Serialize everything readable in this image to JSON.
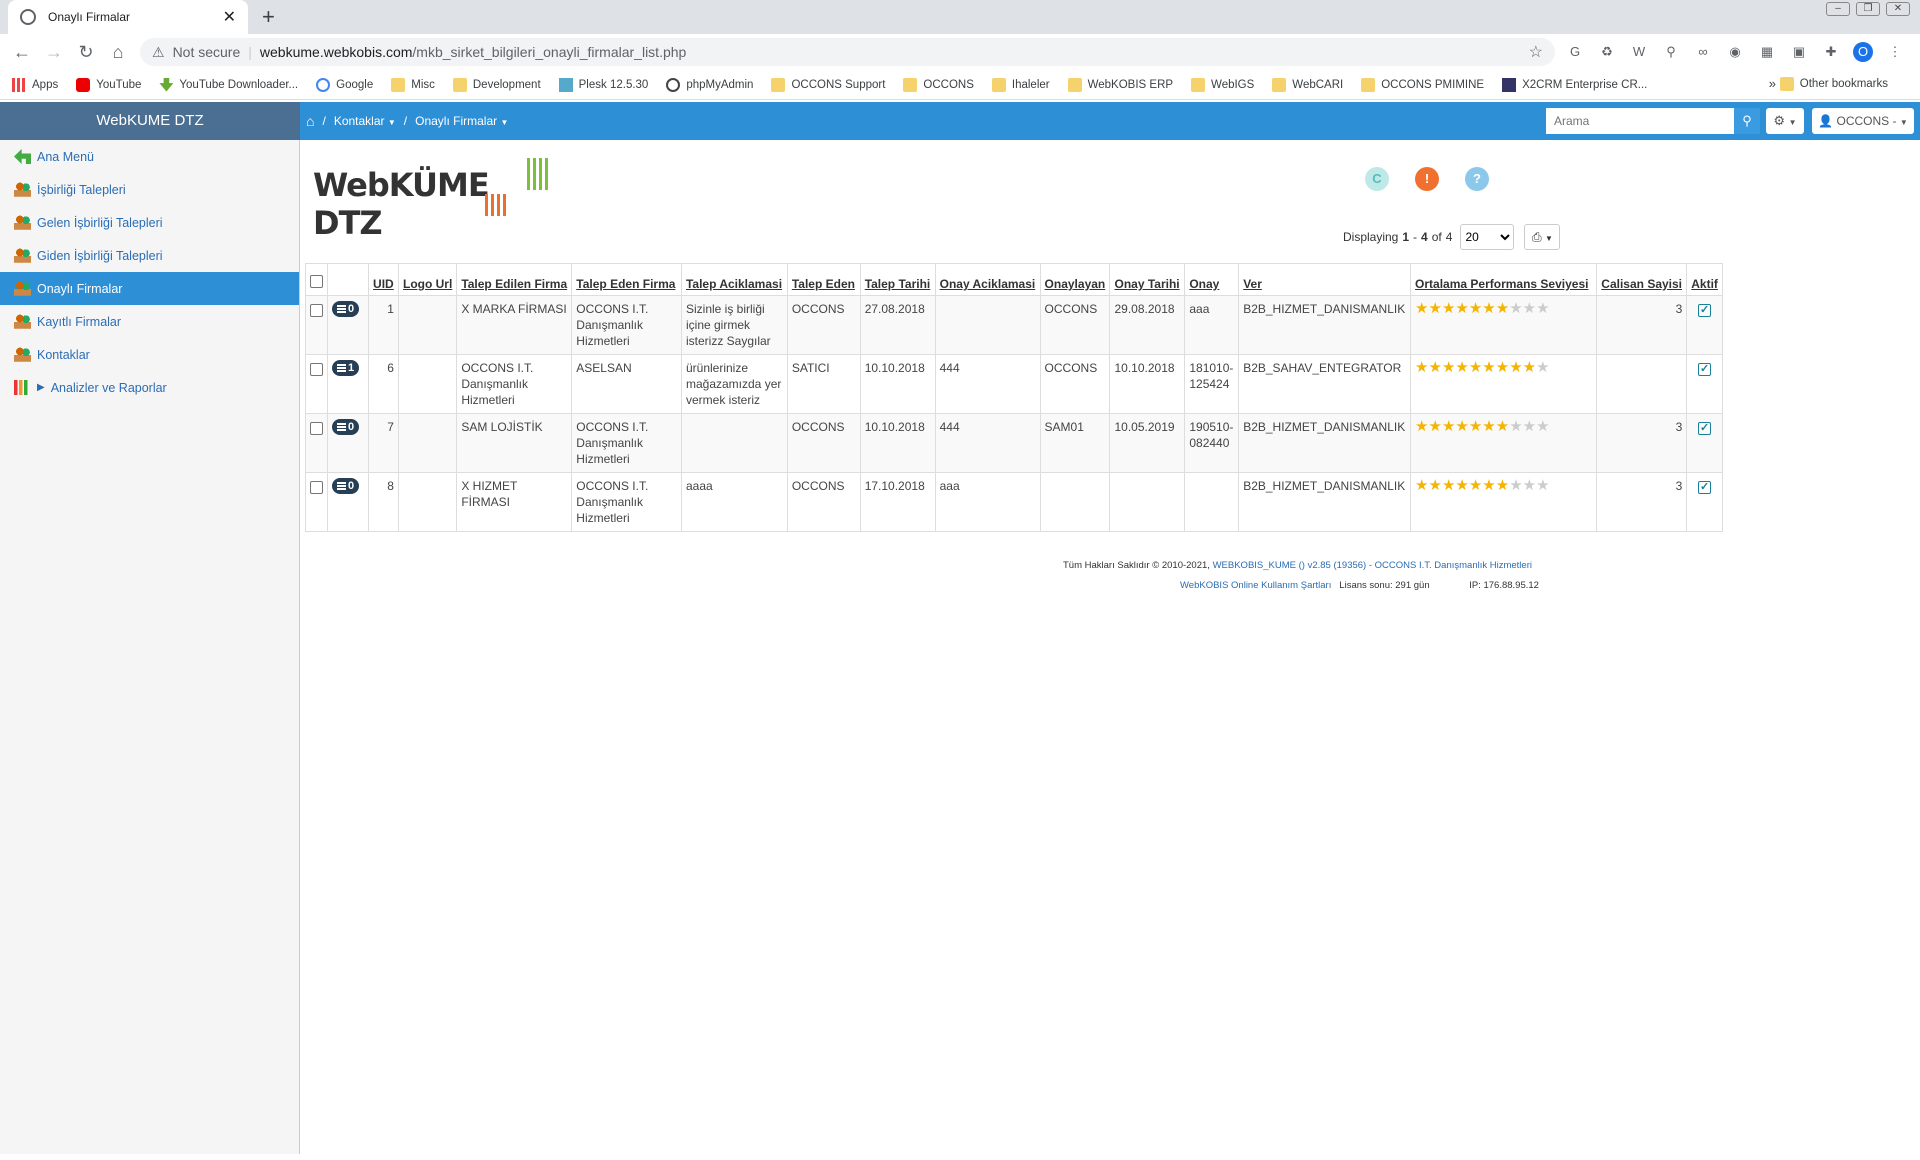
{
  "browser": {
    "tab_title": "Onaylı Firmalar",
    "url_warning": "Not secure",
    "url_host": "webkume.webkobis.com",
    "url_path": "/mkb_sirket_bilgileri_onayli_firmalar_list.php",
    "profile_initial": "O",
    "bookmarks": [
      "Apps",
      "YouTube",
      "YouTube Downloader...",
      "Google",
      "Misc",
      "Development",
      "Plesk 12.5.30",
      "phpMyAdmin",
      "OCCONS Support",
      "OCCONS",
      "Ihaleler",
      "WebKOBIS ERP",
      "WebIGS",
      "WebCARI",
      "OCCONS PMIMINE",
      "X2CRM Enterprise CR..."
    ],
    "bookmarks_more": "»",
    "other_bookmarks": "Other bookmarks"
  },
  "app": {
    "brand": "WebKUME DTZ",
    "logo_text": "WebKÜME DTZ",
    "breadcrumb": [
      "Kontaklar",
      "Onaylı Firmalar"
    ],
    "search_placeholder": "Arama",
    "user_label": "OCCONS -"
  },
  "sidebar": {
    "items": [
      {
        "label": "Ana Menü",
        "icon": "back-arrow-icon"
      },
      {
        "label": "İşbirliği Talepleri",
        "icon": "people-icon"
      },
      {
        "label": "Gelen İşbirliği Talepleri",
        "icon": "people-icon"
      },
      {
        "label": "Giden İşbirliği Talepleri",
        "icon": "people-icon"
      },
      {
        "label": "Onaylı Firmalar",
        "icon": "people-icon",
        "active": true
      },
      {
        "label": "Kayıtlı Firmalar",
        "icon": "people-icon"
      },
      {
        "label": "Kontaklar",
        "icon": "people-icon"
      },
      {
        "label": "Analizler ve Raporlar",
        "icon": "bar-chart-icon"
      }
    ]
  },
  "pager": {
    "prefix": "Displaying",
    "from": "1",
    "dash": "-",
    "to": "4",
    "of": "of",
    "total": "4",
    "page_size": "20"
  },
  "table": {
    "headers": [
      "UID",
      "Logo Url",
      "Talep Edilen Firma",
      "Talep Eden Firma",
      "Talep Aciklamasi",
      "Talep Eden",
      "Talep Tarihi",
      "Onay Aciklamasi",
      "Onaylayan",
      "Onay Tarihi",
      "Onay",
      "Ver",
      "Ortalama Performans Seviyesi",
      "Calisan Sayisi",
      "Aktif"
    ],
    "rows": [
      {
        "badge": "0",
        "uid": "1",
        "logo": "",
        "talep_edilen": "X MARKA FİRMASI",
        "talep_eden_firma": "OCCONS I.T. Danışmanlık Hizmetleri",
        "aciklama": "Sizinle iş birliği içine girmek isterizz Saygılar",
        "talep_eden": "OCCONS",
        "talep_tarihi": "27.08.2018",
        "onay_aciklama": "",
        "onaylayan": "OCCONS",
        "onay_tarihi": "29.08.2018",
        "onay": "aaa",
        "ver": "B2B_HIZMET_DANISMANLIK",
        "stars": 7,
        "calisan": "3",
        "aktif": true
      },
      {
        "badge": "1",
        "uid": "6",
        "logo": "",
        "talep_edilen": "OCCONS I.T. Danışmanlık Hizmetleri",
        "talep_eden_firma": "ASELSAN",
        "aciklama": "ürünlerinize mağazamızda yer vermek isteriz",
        "talep_eden": "SATICI",
        "talep_tarihi": "10.10.2018",
        "onay_aciklama": "444",
        "onaylayan": "OCCONS",
        "onay_tarihi": "10.10.2018",
        "onay": "181010-125424",
        "ver": "B2B_SAHAV_ENTEGRATOR",
        "stars": 9,
        "calisan": "",
        "aktif": true
      },
      {
        "badge": "0",
        "uid": "7",
        "logo": "",
        "talep_edilen": "SAM LOJİSTİK",
        "talep_eden_firma": "OCCONS I.T. Danışmanlık Hizmetleri",
        "aciklama": "",
        "talep_eden": "OCCONS",
        "talep_tarihi": "10.10.2018",
        "onay_aciklama": "444",
        "onaylayan": "SAM01",
        "onay_tarihi": "10.05.2019",
        "onay": "190510-082440",
        "ver": "B2B_HIZMET_DANISMANLIK",
        "stars": 7,
        "calisan": "3",
        "aktif": true
      },
      {
        "badge": "0",
        "uid": "8",
        "logo": "",
        "talep_edilen": "X HIZMET FİRMASI",
        "talep_eden_firma": "OCCONS I.T. Danışmanlık Hizmetleri",
        "aciklama": "aaaa",
        "talep_eden": "OCCONS",
        "talep_tarihi": "17.10.2018",
        "onay_aciklama": "aaa",
        "onaylayan": "",
        "onay_tarihi": "",
        "onay": "",
        "ver": "B2B_HIZMET_DANISMANLIK",
        "stars": 7,
        "calisan": "3",
        "aktif": true
      }
    ],
    "max_stars": 10
  },
  "footer": {
    "copyright": "Tüm Hakları Saklıdır © 2010-2021,",
    "version_link": "WEBKOBIS_KUME () v2.85 (19356) - OCCONS I.T. Danışmanlık Hizmetleri",
    "terms_link": "WebKOBIS Online Kullanım Şartları",
    "license": "Lisans sonu: 291 gün",
    "ip": "IP: 176.88.95.12"
  },
  "colors": {
    "header_blue": "#2d8fd5",
    "brand_bg": "#4a6f92",
    "star": "#f4b400"
  }
}
